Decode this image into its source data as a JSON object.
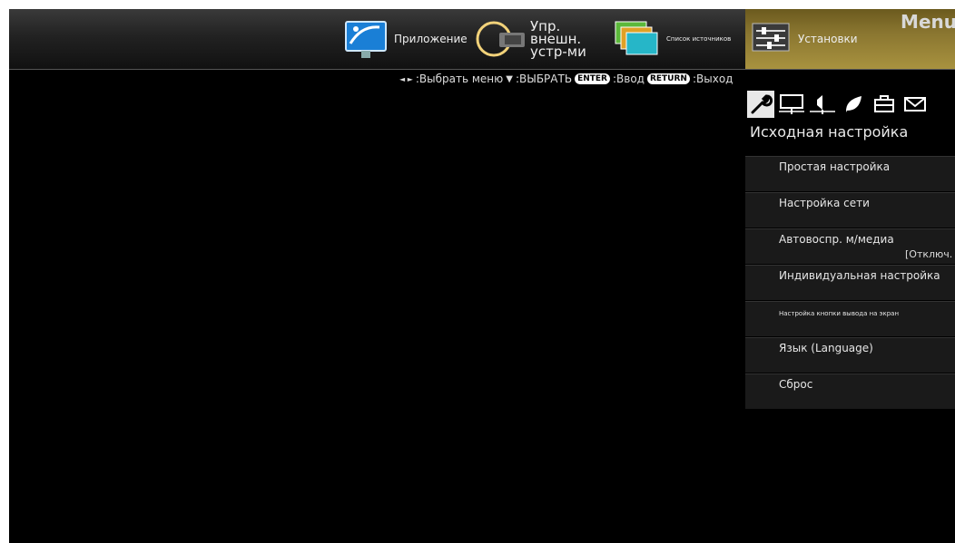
{
  "menu_title": "Menu",
  "top_menu": {
    "app_label": "Приложение",
    "ext_label": "Упр.\nвнешн.\nустр-ми",
    "src_label": "Список источников",
    "settings_label": "Установки"
  },
  "hint": {
    "left_right": "◄ ►",
    "select_menu": ":Выбрать меню",
    "down": "▼",
    "select": ":ВЫБРАТЬ",
    "enter_key": "ENTER",
    "enter_text": ":Ввод",
    "return_key": "RETURN",
    "return_text": ":Выход"
  },
  "category_title": "Исходная настройка",
  "icons": [
    "wrench-icon",
    "monitor-icon",
    "speaker-icon",
    "leaf-icon",
    "toolbox-icon",
    "mail-icon"
  ],
  "settings": [
    {
      "label": "Простая настройка"
    },
    {
      "label": "Настройка сети"
    },
    {
      "label": "Автовоспр. м/медиа",
      "value": "[Отключ."
    },
    {
      "label": "Индивидуальная настройка"
    },
    {
      "label": "Настройка кнопки вывода на экран",
      "small": true
    },
    {
      "label": "Язык (Language)"
    },
    {
      "label": "Сброс"
    }
  ]
}
